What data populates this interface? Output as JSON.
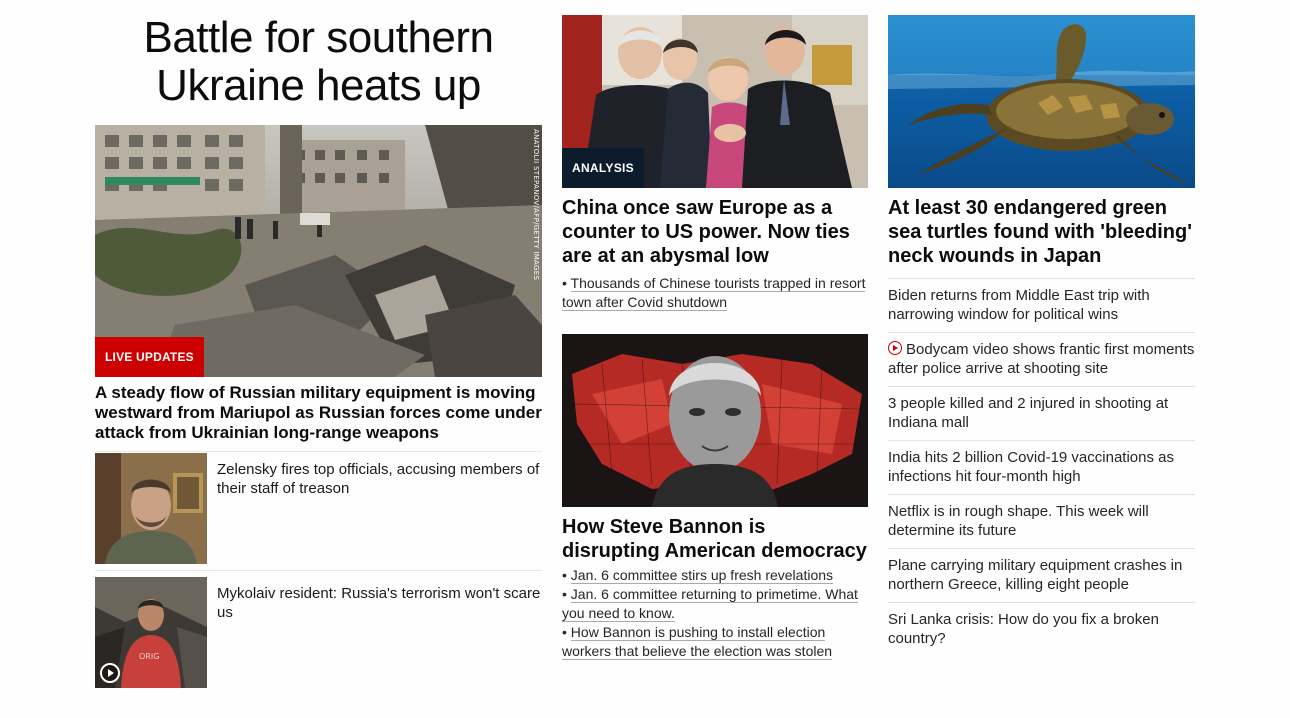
{
  "lead": {
    "headline": "Battle for southern Ukraine heats up",
    "image_label": "LIVE UPDATES",
    "photo_credit": "ANATOLII STEPANOV/AFP/GETTY IMAGES",
    "subheadline": "A steady flow of Russian military equipment is moving westward from Mariupol as Russian forces come under attack from Ukrainian long-range weapons",
    "thumb_stories": [
      {
        "title": "Zelensky fires top officials, accusing members of their staff of treason",
        "video": false
      },
      {
        "title": "Mykolaiv resident: Russia's terrorism won't scare us",
        "video": true
      }
    ]
  },
  "middle": {
    "story1": {
      "label": "ANALYSIS",
      "headline": "China once saw Europe as a counter to US power. Now ties are at an abysmal low",
      "bullets": [
        "Thousands of Chinese tourists trapped in resort town after Covid shutdown"
      ]
    },
    "story2": {
      "headline": "How Steve Bannon is disrupting American democracy",
      "bullets": [
        "Jan. 6 committee stirs up fresh revelations",
        "Jan. 6 committee returning to primetime. What you need to know.",
        "How Bannon is pushing to install election workers that believe the election was stolen"
      ]
    }
  },
  "right": {
    "headline": "At least 30 endangered green sea turtles found with 'bleeding' neck wounds in Japan",
    "links": [
      {
        "title": "Biden returns from Middle East trip with narrowing window for political wins",
        "video": false
      },
      {
        "title": "Bodycam video shows frantic first moments after police arrive at shooting site",
        "video": true
      },
      {
        "title": "3 people killed and 2 injured in shooting at Indiana mall",
        "video": false
      },
      {
        "title": "India hits 2 billion Covid-19 vaccinations as infections hit four-month high",
        "video": false
      },
      {
        "title": "Netflix is in rough shape. This week will determine its future",
        "video": false
      },
      {
        "title": "Plane carrying military equipment crashes in northern Greece, killing eight people",
        "video": false
      },
      {
        "title": "Sri Lanka crisis: How do you fix a broken country?",
        "video": false
      }
    ]
  },
  "colors": {
    "live_red": "#cc0000",
    "analysis_navy": "#0c1c2c",
    "text": "#0c0c0c"
  }
}
